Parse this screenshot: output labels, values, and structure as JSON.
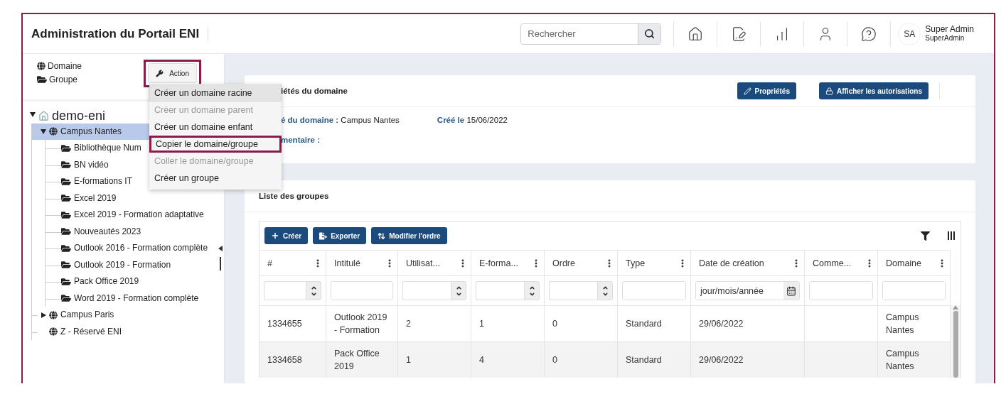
{
  "header": {
    "title": "Administration du Portail ENI",
    "search": {
      "placeholder": "Rechercher"
    },
    "user": {
      "initials": "SA",
      "name": "Super Admin",
      "login": "SuperAdmin"
    }
  },
  "sidebar": {
    "legend": [
      {
        "kind": "globe",
        "label": "Domaine"
      },
      {
        "kind": "folder",
        "label": "Groupe"
      }
    ],
    "action": {
      "label": "Action",
      "highlighted": true
    },
    "action_menu": [
      {
        "label": "Créer un domaine racine",
        "disabled": false,
        "selected": true,
        "highlighted": false
      },
      {
        "label": "Créer un domaine parent",
        "disabled": true,
        "selected": false,
        "highlighted": false
      },
      {
        "label": "Créer un domaine enfant",
        "disabled": false,
        "selected": false,
        "highlighted": false
      },
      {
        "label": "Copier le domaine/groupe",
        "disabled": false,
        "selected": false,
        "highlighted": true
      },
      {
        "label": "Coller le domaine/groupe",
        "disabled": true,
        "selected": false,
        "highlighted": false
      },
      {
        "label": "Créer un groupe",
        "disabled": false,
        "selected": false,
        "highlighted": false
      }
    ],
    "tree": [
      {
        "label": "demo-eni",
        "kind": "home",
        "expanded": true,
        "selected": false,
        "children": [
          {
            "label": "Campus Nantes",
            "kind": "globe",
            "expanded": true,
            "selected": true,
            "children": [
              {
                "label": "Bibliothèque Num",
                "kind": "folder",
                "selected": false
              },
              {
                "label": "BN vidéo",
                "kind": "folder",
                "selected": false
              },
              {
                "label": "E-formations IT",
                "kind": "folder",
                "selected": false
              },
              {
                "label": "Excel 2019",
                "kind": "folder",
                "selected": false
              },
              {
                "label": "Excel 2019 - Formation adaptative",
                "kind": "folder",
                "selected": false
              },
              {
                "label": "Nouveautés 2023",
                "kind": "folder",
                "selected": false
              },
              {
                "label": "Outlook 2016 - Formation complète",
                "kind": "folder",
                "selected": false
              },
              {
                "label": "Outlook 2019 - Formation",
                "kind": "folder",
                "selected": false
              },
              {
                "label": "Pack Office 2019",
                "kind": "folder",
                "selected": false
              },
              {
                "label": "Word 2019 - Formation complète",
                "kind": "folder",
                "selected": false
              }
            ]
          },
          {
            "label": "Campus Paris",
            "kind": "globe",
            "expanded": false,
            "selected": false
          },
          {
            "label": "Z - Réservé ENI",
            "kind": "globe",
            "selected": false
          }
        ]
      }
    ]
  },
  "properties": {
    "title": "iétés du domaine",
    "buttons": [
      {
        "kind": "edit",
        "label": "Propriétés"
      },
      {
        "kind": "lock",
        "label": "Afficher les autorisations"
      }
    ],
    "fields": [
      {
        "label": "é du domaine :",
        "value": "Campus Nantes"
      },
      {
        "label": "Créé le",
        "value": "15/06/2022"
      }
    ],
    "comment_label": "mentaire :"
  },
  "groups": {
    "title": "Liste des groupes",
    "toolbar": [
      {
        "kind": "plus",
        "label": "Créer"
      },
      {
        "kind": "export",
        "label": "Exporter"
      },
      {
        "kind": "sort",
        "label": "Modifier l'ordre"
      }
    ],
    "columns": [
      {
        "label": "#",
        "kind": "number"
      },
      {
        "label": "Intitulé",
        "kind": "text"
      },
      {
        "label": "Utilisat...",
        "kind": "number"
      },
      {
        "label": "E-forma...",
        "kind": "number"
      },
      {
        "label": "Ordre",
        "kind": "number"
      },
      {
        "label": "Type",
        "kind": "text"
      },
      {
        "label": "Date de création",
        "kind": "date",
        "placeholder": "jour/mois/année"
      },
      {
        "label": "Comme...",
        "kind": "text"
      },
      {
        "label": "Domaine",
        "kind": "text"
      }
    ],
    "rows": [
      [
        "1334655",
        "Outlook 2019 - Formation",
        "2",
        "1",
        "0",
        "Standard",
        "29/06/2022",
        "",
        "Campus Nantes"
      ],
      [
        "1334658",
        "Pack Office 2019",
        "1",
        "4",
        "0",
        "Standard",
        "29/06/2022",
        "",
        "Campus Nantes"
      ]
    ]
  }
}
